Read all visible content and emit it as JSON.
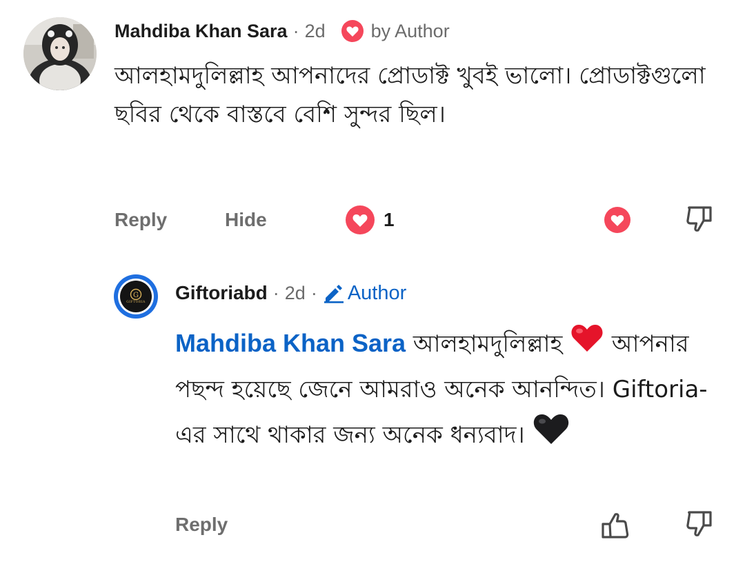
{
  "comment": {
    "author": "Mahdiba Khan Sara",
    "time": "2d",
    "author_like_label": "by Author",
    "body": "আলহামদুলিল্লাহ আপনাদের প্রোডাক্ট খুবই ভালো। প্রোডাক্টগুলো ছবির থেকে বাস্তবে বেশি সুন্দর ছিল।",
    "actions": {
      "reply": "Reply",
      "hide": "Hide",
      "reaction_count": "1"
    }
  },
  "reply": {
    "author": "Giftoriabd",
    "time": "2d",
    "author_badge": "Author",
    "avatar_text": "GIFTORIA",
    "mention": "Mahdiba Khan Sara",
    "body_part1": " আলহামদুলিল্লাহ ",
    "body_part2": " আপনার পছন্দ হয়েছে জেনে আমরাও অনেক আনন্দিত। Giftoria-এর সাথে থাকার জন্য অনেক ধন্যবাদ। ",
    "actions": {
      "reply": "Reply"
    }
  },
  "icons": {
    "heart_badge": "heart-icon",
    "like": "thumbs-up-icon",
    "dislike": "thumbs-down-icon",
    "author_tag": "pencil-icon"
  },
  "colors": {
    "heart_red": "#f5475b",
    "link_blue": "#0b63c6",
    "avatar_ring": "#1f6fe0",
    "muted_text": "#6b6b6b"
  }
}
